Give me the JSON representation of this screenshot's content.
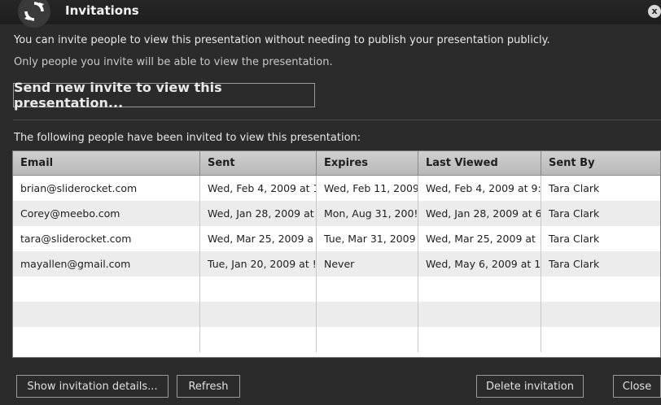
{
  "window": {
    "title": "Invitations",
    "logo_icon": "refresh-arrows-icon",
    "close_symbol": "x"
  },
  "messages": {
    "line1": "You can invite people to view this presentation without needing to publish your presentation publicly.",
    "line2": "Only people you invite will be able to view the presentation."
  },
  "send_button": "Send new invite to view this presentation...",
  "table": {
    "caption": "The following people have been invited to view this presentation:",
    "columns": [
      "Email",
      "Sent",
      "Expires",
      "Last Viewed",
      "Sent By"
    ],
    "rows": [
      [
        "brian@sliderocket.com",
        "Wed, Feb 4, 2009 at 1",
        "Wed, Feb 11, 2009",
        "Wed, Feb 4, 2009 at 9:",
        "Tara Clark"
      ],
      [
        "Corey@meebo.com",
        "Wed, Jan 28, 2009 at",
        "Mon, Aug 31, 200!",
        "Wed, Jan 28, 2009 at 6",
        "Tara Clark"
      ],
      [
        "tara@sliderocket.com",
        "Wed, Mar 25, 2009 a",
        "Tue, Mar 31, 2009",
        "Wed, Mar 25, 2009 at",
        "Tara Clark"
      ],
      [
        "mayallen@gmail.com",
        "Tue, Jan 20, 2009 at !",
        "Never",
        "Wed, May 6, 2009 at 1",
        "Tara Clark"
      ]
    ]
  },
  "footer": {
    "details_button": "Show invitation details...",
    "refresh_button": "Refresh",
    "delete_button": "Delete invitation",
    "close_button": "Close"
  }
}
